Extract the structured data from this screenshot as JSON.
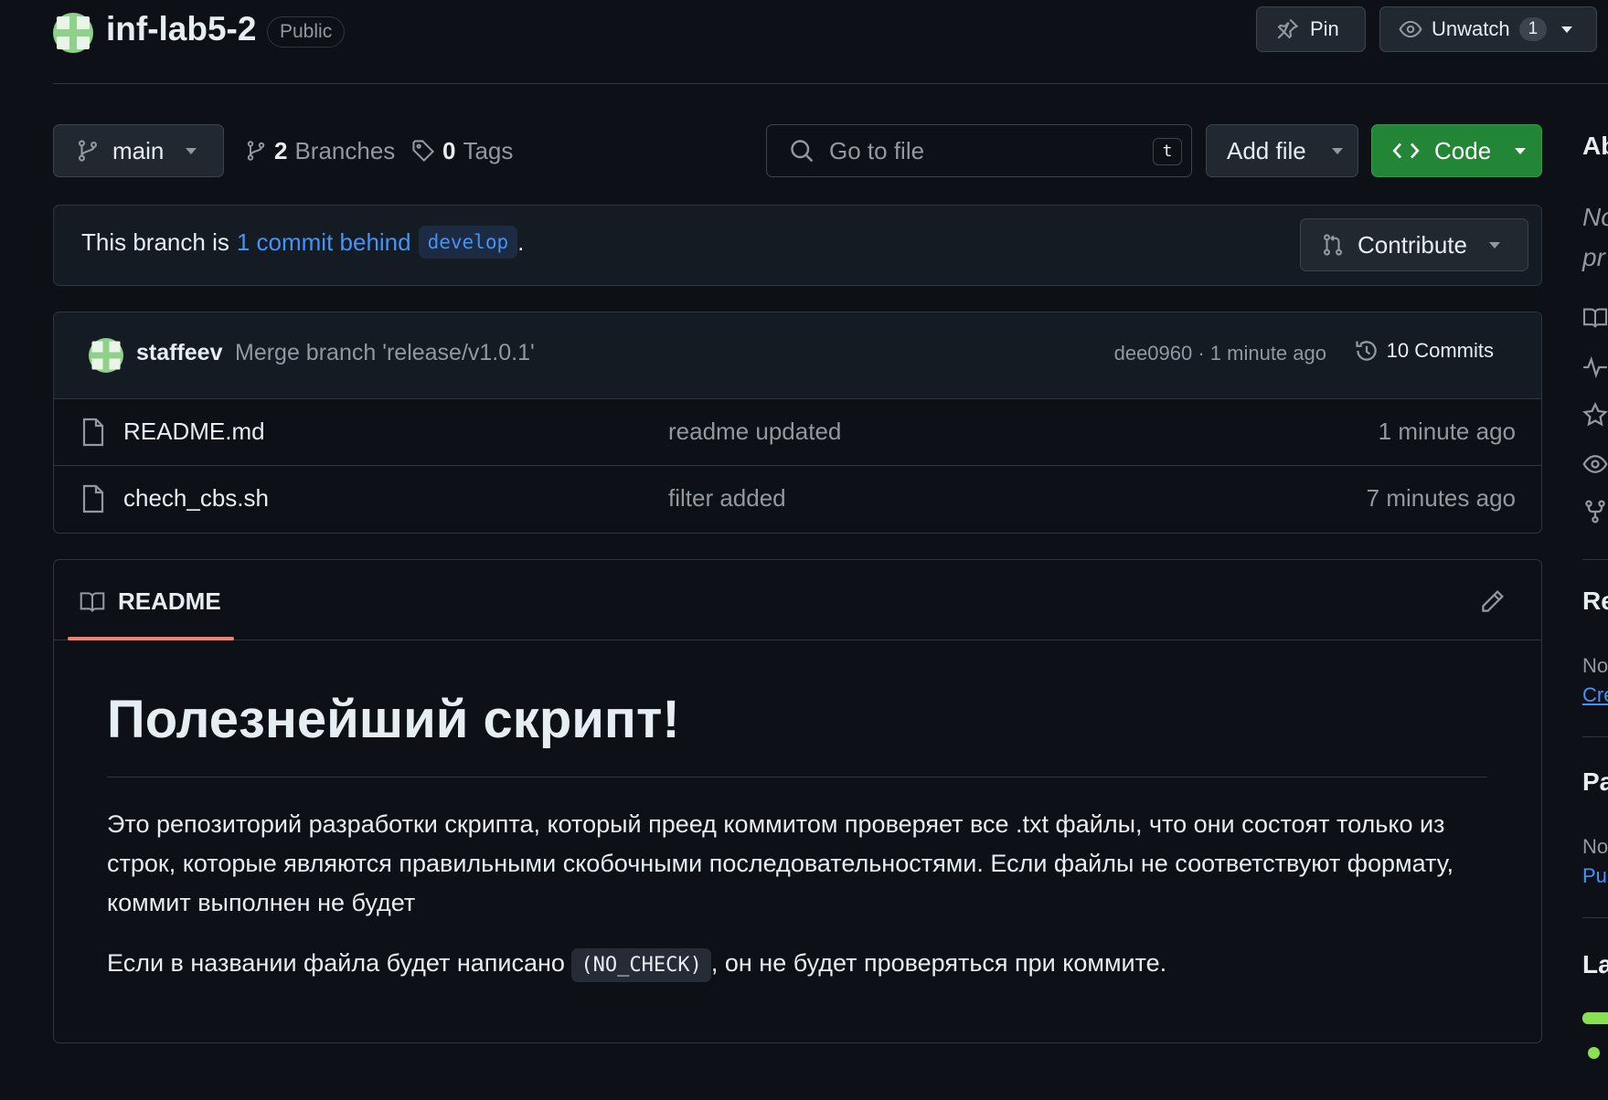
{
  "repo": {
    "name": "inf-lab5-2",
    "visibility": "Public",
    "pin_label": "Pin",
    "watch_label": "Unwatch",
    "watch_count": "1"
  },
  "toolbar": {
    "branch": "main",
    "branches_count": "2",
    "branches_label": "Branches",
    "tags_count": "0",
    "tags_label": "Tags",
    "search_placeholder": "Go to file",
    "search_shortcut": "t",
    "add_file_label": "Add file",
    "code_label": "Code"
  },
  "branch_notice": {
    "prefix": "This branch is",
    "link": "1 commit behind",
    "target_branch": "develop",
    "suffix": ".",
    "contribute_label": "Contribute"
  },
  "latest_commit": {
    "author": "staffeev",
    "message": "Merge branch 'release/v1.0.1'",
    "meta": "dee0960 · 1 minute ago",
    "commits_label": "10 Commits"
  },
  "files": [
    {
      "name": "README.md",
      "message": "readme updated",
      "time": "1 minute ago"
    },
    {
      "name": "chech_cbs.sh",
      "message": "filter added",
      "time": "7 minutes ago"
    }
  ],
  "readme": {
    "tab_label": "README",
    "heading": "Полезнейший скрипт!",
    "paragraph1": "Это репозиторий разработки скрипта, который преед коммитом проверяет все .txt файлы, что они состоят только из строк, которые являются правильными скобочными последовательностями. Если файлы не соответствуют формату, коммит выполнен не будет",
    "paragraph2_before": "Если в названии файла будет написано",
    "paragraph2_code": "(NO_CHECK)",
    "paragraph2_after": ", он не будет проверяться при коммите."
  },
  "sidebar": {
    "about_heading": "Ab",
    "about_text_1": "No",
    "about_text_2": "pr",
    "releases_heading": "Re",
    "releases_text": "No",
    "releases_link": "Cre",
    "packages_heading": "Pa",
    "packages_text": "No",
    "packages_link": "Pul",
    "languages_heading": "La"
  },
  "colors": {
    "background": "#0d1117",
    "accent_link": "#4493f8",
    "code_button": "#238636",
    "readme_tab_underline": "#f78166",
    "language_bar": "#89e051"
  }
}
